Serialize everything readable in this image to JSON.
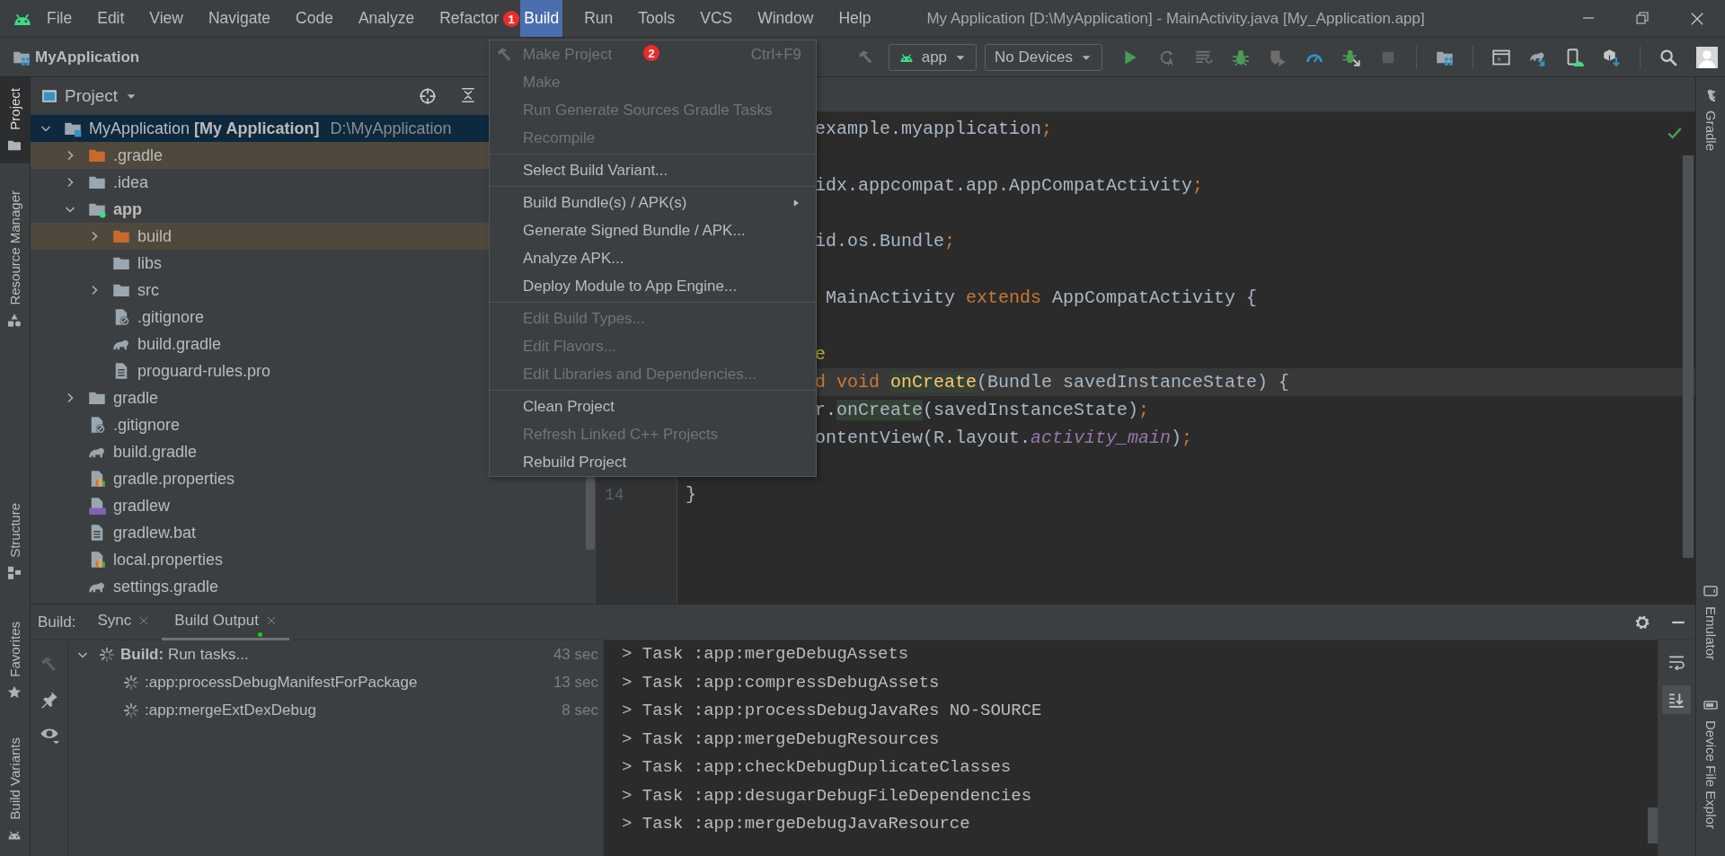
{
  "window": {
    "title": "My Application [D:\\MyApplication] - MainActivity.java [My_Application.app]",
    "menus": [
      {
        "label": "File",
        "selected": false
      },
      {
        "label": "Edit",
        "selected": false
      },
      {
        "label": "View",
        "selected": false
      },
      {
        "label": "Navigate",
        "selected": false
      },
      {
        "label": "Code",
        "selected": false
      },
      {
        "label": "Analyze",
        "selected": false
      },
      {
        "label": "Refactor",
        "selected": false
      },
      {
        "label": "Build",
        "selected": true
      },
      {
        "label": "Run",
        "selected": false
      },
      {
        "label": "Tools",
        "selected": false
      },
      {
        "label": "VCS",
        "selected": false
      },
      {
        "label": "Window",
        "selected": false
      },
      {
        "label": "Help",
        "selected": false
      }
    ]
  },
  "navigation": {
    "breadcrumb": "MyApplication",
    "run_configuration": "app",
    "device": "No Devices"
  },
  "left_strip": {
    "top": [
      {
        "label": "Project",
        "kind": "folder",
        "selected": true
      },
      {
        "label": "Resource Manager",
        "kind": "shapes",
        "selected": false
      }
    ],
    "middle": [
      {
        "label": "Structure",
        "kind": "structure",
        "selected": false
      }
    ],
    "bottom": [
      {
        "label": "Favorites",
        "kind": "star",
        "selected": false
      },
      {
        "label": "Build Variants",
        "kind": "android",
        "selected": false
      }
    ]
  },
  "right_strip": {
    "top": [
      {
        "label": "Gradle",
        "kind": "elephant",
        "selected": false
      }
    ],
    "bottom": [
      {
        "label": "Emulator",
        "kind": "device",
        "selected": false
      },
      {
        "label": "Device File Explor",
        "kind": "phone",
        "selected": false
      }
    ]
  },
  "project": {
    "title": "Project",
    "tree": [
      {
        "label": "MyApplication **[My Application]**",
        "path": "D:\\MyApplication",
        "kind": "project",
        "selected": true,
        "excluded": false,
        "expanded": true,
        "children": [
          {
            "label": ".gradle",
            "kind": "folder",
            "selected": false,
            "excluded": true,
            "expanded": false
          },
          {
            "label": ".idea",
            "kind": "folder",
            "selected": false,
            "excluded": false,
            "expanded": false
          },
          {
            "label": "app",
            "kind": "module",
            "selected": false,
            "excluded": false,
            "expanded": true,
            "children": [
              {
                "label": "build",
                "kind": "folder",
                "selected": false,
                "excluded": true,
                "expanded": false
              },
              {
                "label": "libs",
                "kind": "folder",
                "selected": false,
                "excluded": false
              },
              {
                "label": "src",
                "kind": "folder",
                "selected": false,
                "excluded": false,
                "expanded": false
              },
              {
                "label": ".gitignore",
                "kind": "ignore-file",
                "selected": false,
                "excluded": false
              },
              {
                "label": "build.gradle",
                "kind": "gradle-file",
                "selected": false,
                "excluded": false
              },
              {
                "label": "proguard-rules.pro",
                "kind": "text-file",
                "selected": false,
                "excluded": false
              }
            ]
          },
          {
            "label": "gradle",
            "kind": "folder",
            "selected": false,
            "excluded": false,
            "expanded": false
          },
          {
            "label": ".gitignore",
            "kind": "ignore-file",
            "selected": false,
            "excluded": false
          },
          {
            "label": "build.gradle",
            "kind": "gradle-file",
            "selected": false,
            "excluded": false
          },
          {
            "label": "gradle.properties",
            "kind": "properties-file",
            "selected": false,
            "excluded": false
          },
          {
            "label": "gradlew",
            "kind": "script-file",
            "selected": false,
            "excluded": false
          },
          {
            "label": "gradlew.bat",
            "kind": "text-file",
            "selected": false,
            "excluded": false
          },
          {
            "label": "local.properties",
            "kind": "properties-file",
            "selected": false,
            "excluded": false
          },
          {
            "label": "settings.gradle",
            "kind": "gradle-file",
            "selected": false,
            "excluded": false
          }
        ]
      }
    ]
  },
  "editor": {
    "lines": [
      {
        "kind": "covered",
        "current": false,
        "tokens": [
          {
            "text": "example.myapplication",
            "kind": "plain"
          },
          {
            "text": ";",
            "kind": "punct"
          }
        ]
      },
      {
        "kind": "covered",
        "current": false
      },
      {
        "kind": "covered",
        "current": false,
        "tokens": [
          {
            "text": "idx.appcompat.app.AppCompatActivity",
            "kind": "plain"
          },
          {
            "text": ";",
            "kind": "punct"
          }
        ]
      },
      {
        "kind": "covered",
        "current": false
      },
      {
        "kind": "covered",
        "current": false,
        "tokens": [
          {
            "text": "id.os.Bundle",
            "kind": "plain"
          },
          {
            "text": ";",
            "kind": "punct"
          }
        ]
      },
      {
        "kind": "covered",
        "current": false
      },
      {
        "kind": "covered",
        "current": false,
        "tokens": [
          {
            "text": " MainActivity ",
            "kind": "plain"
          },
          {
            "text": "extends",
            "kind": "keyword"
          },
          {
            "text": " AppCompatActivity {",
            "kind": "plain"
          }
        ]
      },
      {
        "kind": "covered",
        "current": false
      },
      {
        "kind": "covered",
        "current": false,
        "tokens": [
          {
            "text": "e",
            "kind": "annotation"
          }
        ]
      },
      {
        "kind": "covered",
        "current": true,
        "tokens": [
          {
            "text": "d void ",
            "kind": "keyword"
          },
          {
            "text": "onCreate",
            "kind": "declaration"
          },
          {
            "text": "(Bundle savedInstanceState) {",
            "kind": "plain"
          }
        ]
      },
      {
        "kind": "covered",
        "current": false,
        "tokens": [
          {
            "text": "r.",
            "kind": "plain"
          },
          {
            "text": "onCreate",
            "kind": "usage"
          },
          {
            "text": "(savedInstanceState)",
            "kind": "plain"
          },
          {
            "text": ";",
            "kind": "punct"
          }
        ]
      },
      {
        "kind": "covered",
        "current": false,
        "tokens": [
          {
            "text": "ontentView(R.layout.",
            "kind": "plain"
          },
          {
            "text": "activity_main",
            "kind": "field"
          },
          {
            "text": ")",
            "kind": "plain"
          },
          {
            "text": ";",
            "kind": "punct"
          }
        ]
      },
      {
        "kind": "covered",
        "current": false
      },
      {
        "kind": "full",
        "current": false,
        "number": "14",
        "tokens": [
          {
            "text": "}",
            "kind": "plain"
          }
        ]
      }
    ]
  },
  "build_menu": {
    "items": [
      {
        "kind": "tool",
        "label": "Make Project",
        "shortcut": "Ctrl+F9",
        "disabled": true
      },
      {
        "kind": "item",
        "label": "Make",
        "disabled": true
      },
      {
        "kind": "item",
        "label": "Run Generate Sources Gradle Tasks",
        "disabled": true
      },
      {
        "kind": "item",
        "label": "Recompile",
        "disabled": true
      },
      {
        "kind": "separator"
      },
      {
        "kind": "item",
        "label": "Select Build Variant...",
        "disabled": false
      },
      {
        "kind": "separator"
      },
      {
        "kind": "submenu",
        "label": "Build Bundle(s) / APK(s)",
        "disabled": false
      },
      {
        "kind": "item",
        "label": "Generate Signed Bundle / APK...",
        "disabled": false
      },
      {
        "kind": "item",
        "label": "Analyze APK...",
        "disabled": false
      },
      {
        "kind": "item",
        "label": "Deploy Module to App Engine...",
        "disabled": false
      },
      {
        "kind": "separator"
      },
      {
        "kind": "item",
        "label": "Edit Build Types...",
        "disabled": true
      },
      {
        "kind": "item",
        "label": "Edit Flavors...",
        "disabled": true
      },
      {
        "kind": "item",
        "label": "Edit Libraries and Dependencies...",
        "disabled": true
      },
      {
        "kind": "separator"
      },
      {
        "kind": "item",
        "label": "Clean Project",
        "disabled": false
      },
      {
        "kind": "item",
        "label": "Refresh Linked C++ Projects",
        "disabled": true
      },
      {
        "kind": "item",
        "label": "Rebuild Project",
        "disabled": false
      }
    ]
  },
  "callouts": [
    {
      "text": "1"
    },
    {
      "text": "2"
    }
  ],
  "build_panel": {
    "title": "Build:",
    "tabs": [
      {
        "label": "Sync",
        "selected": false,
        "has_update": false
      },
      {
        "label": "Build Output",
        "selected": true,
        "has_update": true
      }
    ],
    "tree": [
      {
        "label": "**Build:** Run tasks...",
        "time": "43 sec",
        "expanded": true,
        "children": [
          {
            "label": ":app:processDebugManifestForPackage",
            "time": "13 sec"
          },
          {
            "label": ":app:mergeExtDexDebug",
            "time": "8 sec"
          }
        ]
      }
    ],
    "output": [
      "> Task :app:mergeDebugAssets",
      "> Task :app:compressDebugAssets",
      "> Task :app:processDebugJavaRes NO-SOURCE",
      "> Task :app:mergeDebugResources",
      "> Task :app:checkDebugDuplicateClasses",
      "> Task :app:desugarDebugFileDependencies",
      "> Task :app:mergeDebugJavaResource"
    ],
    "output_tools": [
      {
        "kind": "soft-wrap",
        "selected": false
      },
      {
        "kind": "scroll-to-end",
        "selected": true
      }
    ]
  }
}
